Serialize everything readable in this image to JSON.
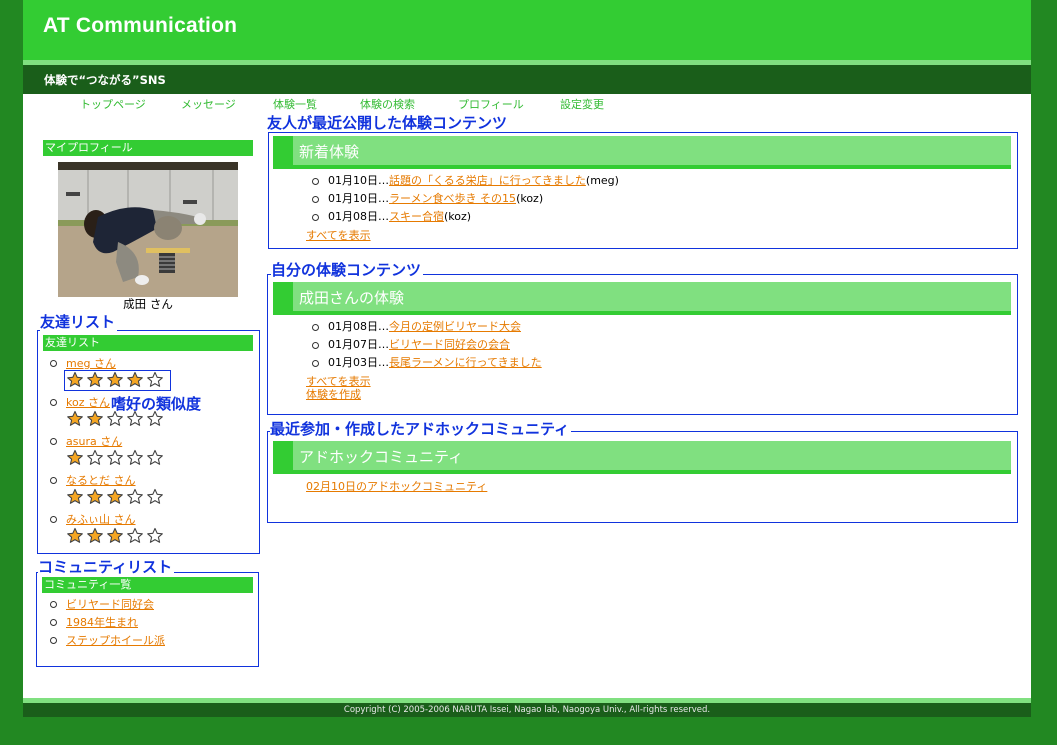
{
  "header": {
    "site_title": "AT Communication",
    "tagline": "体験で“つながる”SNS"
  },
  "nav": {
    "items": [
      {
        "label": "トップページ"
      },
      {
        "label": "メッセージ"
      },
      {
        "label": "体験一覧"
      },
      {
        "label": "体験の検索"
      },
      {
        "label": "プロフィール"
      },
      {
        "label": "設定変更"
      }
    ]
  },
  "sidebar": {
    "profile": {
      "heading": "マイプロフィール",
      "photo_alt": "profile photo",
      "name": "成田 さん"
    },
    "friends": {
      "legend": "友達リスト",
      "heading": "友達リスト",
      "annotation": "嗜好の類似度",
      "max_stars": 5,
      "items": [
        {
          "name": "meg さん",
          "rating": 4
        },
        {
          "name": "koz さん",
          "rating": 2
        },
        {
          "name": "asura さん",
          "rating": 1
        },
        {
          "name": "なるとだ さん",
          "rating": 3
        },
        {
          "name": "みふぃ山 さん",
          "rating": 3
        }
      ]
    },
    "communities": {
      "legend": "コミュニティリスト",
      "heading": "コミュニティ一覧",
      "items": [
        {
          "name": "ビリヤード同好会"
        },
        {
          "name": "1984年生まれ"
        },
        {
          "name": "ステップホイール派"
        }
      ]
    }
  },
  "main": {
    "friends_recent": {
      "legend": "友人が最近公開した体験コンテンツ",
      "panel_title": "新着体験",
      "entries": [
        {
          "date": "01月10日…",
          "title": "話題の「くるる栄店」に行ってきました",
          "author": "(meg)"
        },
        {
          "date": "01月10日…",
          "title": "ラーメン食べ歩き その15",
          "author": "(koz)"
        },
        {
          "date": "01月08日…",
          "title": "スキー合宿",
          "author": "(koz)"
        }
      ],
      "show_all": "すべてを表示"
    },
    "my_contents": {
      "legend": "自分の体験コンテンツ",
      "panel_title": "成田さんの体験",
      "entries": [
        {
          "date": "01月08日…",
          "title": "今月の定例ビリヤード大会"
        },
        {
          "date": "01月07日…",
          "title": "ビリヤード同好会の会合"
        },
        {
          "date": "01月03日…",
          "title": "長尾ラーメンに行ってきました"
        }
      ],
      "show_all": "すべてを表示",
      "create": "体験を作成"
    },
    "adhoc": {
      "legend": "最近参加・作成したアドホックコミュニティ",
      "panel_title": "アドホックコミュニティ",
      "link": "02月10日のアドホックコミュニティ"
    }
  },
  "footer": {
    "copyright": "Copyright (C)  2005-2006 NARUTA Issei, Nagao lab, Naogoya Univ., All-rights reserved."
  },
  "colors": {
    "outer_bg": "#228822",
    "header_green": "#33cc33",
    "light_green": "#80e080",
    "dark_green": "#1a5e1a",
    "link_orange": "#e67a00",
    "annotation_blue": "#1133dd",
    "nav_green": "#33bb33"
  }
}
